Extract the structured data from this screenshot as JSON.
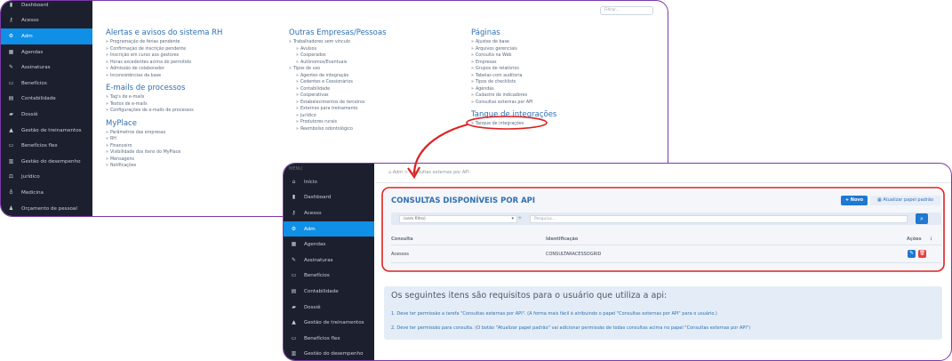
{
  "win1": {
    "sidebar": [
      {
        "label": "Dashboard",
        "icon": "bar-chart-icon"
      },
      {
        "label": "Acesso",
        "icon": "key-icon"
      },
      {
        "label": "Adm",
        "icon": "gear-icon",
        "active": true
      },
      {
        "label": "Agendas",
        "icon": "calendar-icon"
      },
      {
        "label": "Assinaturas",
        "icon": "pen-icon"
      },
      {
        "label": "Benefícios",
        "icon": "card-icon"
      },
      {
        "label": "Contabilidade",
        "icon": "calculator-icon"
      },
      {
        "label": "Dossiê",
        "icon": "folder-icon"
      },
      {
        "label": "Gestão de treinamentos",
        "icon": "graduation-icon"
      },
      {
        "label": "Benefícios flex",
        "icon": "card-flex-icon"
      },
      {
        "label": "Gestão do desempenho",
        "icon": "chart-icon"
      },
      {
        "label": "Jurídico",
        "icon": "scale-icon"
      },
      {
        "label": "Medicina",
        "icon": "stethoscope-icon"
      },
      {
        "label": "Orçamento de pessoal",
        "icon": "people-icon"
      }
    ],
    "filter_placeholder": "Filtrar...",
    "columns": [
      {
        "sections": [
          {
            "title": "Alertas e avisos do sistema RH",
            "items": [
              {
                "t": "Programação de férias pendente"
              },
              {
                "t": "Confirmação de inscrição pendente"
              },
              {
                "t": "Inscrição em curso aos gestores"
              },
              {
                "t": "Horas excedentes acima do permitido"
              },
              {
                "t": "Admissão de colaborador"
              },
              {
                "t": "Inconsistências da base"
              }
            ]
          },
          {
            "title": "E-mails de processos",
            "items": [
              {
                "t": "Tag's de e-mails"
              },
              {
                "t": "Textos de e-mails"
              },
              {
                "t": "Configurações de e-mails de processos"
              }
            ]
          },
          {
            "title": "MyPlace",
            "items": [
              {
                "t": "Parâmetros das empresas"
              },
              {
                "t": "RH"
              },
              {
                "t": "Financeiro"
              },
              {
                "t": "Visibilidade dos itens do MyPlace"
              },
              {
                "t": "Mensagens"
              },
              {
                "t": "Notificações"
              }
            ]
          }
        ]
      },
      {
        "sections": [
          {
            "title": "Outras Empresas/Pessoas",
            "items": [
              {
                "t": "Trabalhadores sem vínculo"
              },
              {
                "t": "Avulsos",
                "sub": true
              },
              {
                "t": "Cooperados",
                "sub": true
              },
              {
                "t": "Autônomos/Eventuais",
                "sub": true
              },
              {
                "t": "Tipos de uso"
              },
              {
                "t": "Agentes de integração",
                "sub": true
              },
              {
                "t": "Cedentes e Cessionários",
                "sub": true
              },
              {
                "t": "Contabilidade",
                "sub": true
              },
              {
                "t": "Cooperativas",
                "sub": true
              },
              {
                "t": "Estabelecimentos de terceiros",
                "sub": true
              },
              {
                "t": "Externos para treinamento",
                "sub": true
              },
              {
                "t": "Jurídico",
                "sub": true
              },
              {
                "t": "Produtores rurais",
                "sub": true
              },
              {
                "t": "Reembolso odontológico",
                "sub": true
              }
            ]
          }
        ]
      },
      {
        "sections": [
          {
            "title": "Páginas",
            "items": [
              {
                "t": "Ajustes de base"
              },
              {
                "t": "Arquivos gerenciais"
              },
              {
                "t": "Consulta na Web"
              },
              {
                "t": "Empresas"
              },
              {
                "t": "Grupos de relatórios"
              },
              {
                "t": "Tabelas com auditoria"
              },
              {
                "t": "Tipos de checklists"
              },
              {
                "t": "Agendas"
              },
              {
                "t": "Cadastro de indicadores"
              },
              {
                "t": "Consultas externas por API"
              }
            ]
          },
          {
            "title": "Tanque de integrações",
            "items": [
              {
                "t": "Tanque de integrações"
              }
            ]
          }
        ]
      }
    ]
  },
  "win2": {
    "menu_label": "MENU",
    "sidebar": [
      {
        "label": "Início",
        "icon": "home-icon"
      },
      {
        "label": "Dashboard",
        "icon": "bar-chart-icon"
      },
      {
        "label": "Acesso",
        "icon": "key-icon"
      },
      {
        "label": "Adm",
        "icon": "gear-icon",
        "active": true
      },
      {
        "label": "Agendas",
        "icon": "calendar-icon"
      },
      {
        "label": "Assinaturas",
        "icon": "pen-icon"
      },
      {
        "label": "Benefícios",
        "icon": "card-icon"
      },
      {
        "label": "Contabilidade",
        "icon": "calculator-icon"
      },
      {
        "label": "Dossiê",
        "icon": "folder-icon"
      },
      {
        "label": "Gestão de treinamentos",
        "icon": "graduation-icon"
      },
      {
        "label": "Benefícios flex",
        "icon": "card-flex-icon"
      },
      {
        "label": "Gestão do desempenho",
        "icon": "chart-icon"
      }
    ],
    "breadcrumb": "Adm > Consultas externas por API",
    "title": "CONSULTAS DISPONÍVEIS POR API",
    "btn_new": "+ Novo",
    "btn_role": "Atualizar papel padrão",
    "filter_select": "(sem filtro)",
    "search_placeholder": "Pesquisa...",
    "table": {
      "headers": {
        "consulta": "Consulta",
        "identificacao": "Identificação",
        "acoes": "Ações"
      },
      "rows": [
        {
          "consulta": "Acessos",
          "identificacao": "CONSULTARACESSOGRID"
        }
      ]
    },
    "requirements": {
      "title": "Os seguintes itens são requisitos para o usuário que utiliza a api:",
      "items": [
        "1. Deve ter permissão a tarefa \"Consultas externas por API\". (A forma mais fácil é atribuindo o papel \"Consultas externas por API\" para o usuário.)",
        "2. Deve ter permissão para consulta. (O botão \"Atualizar papel padrão\" vai adicionar permissão de todas consultas acima no papel \"Consultas externas por API\")"
      ]
    }
  },
  "colors": {
    "accent": "#0f8fe6",
    "annotation": "#e02020",
    "frame": "#7b3aa8",
    "sidebar": "#1c1f2e"
  }
}
